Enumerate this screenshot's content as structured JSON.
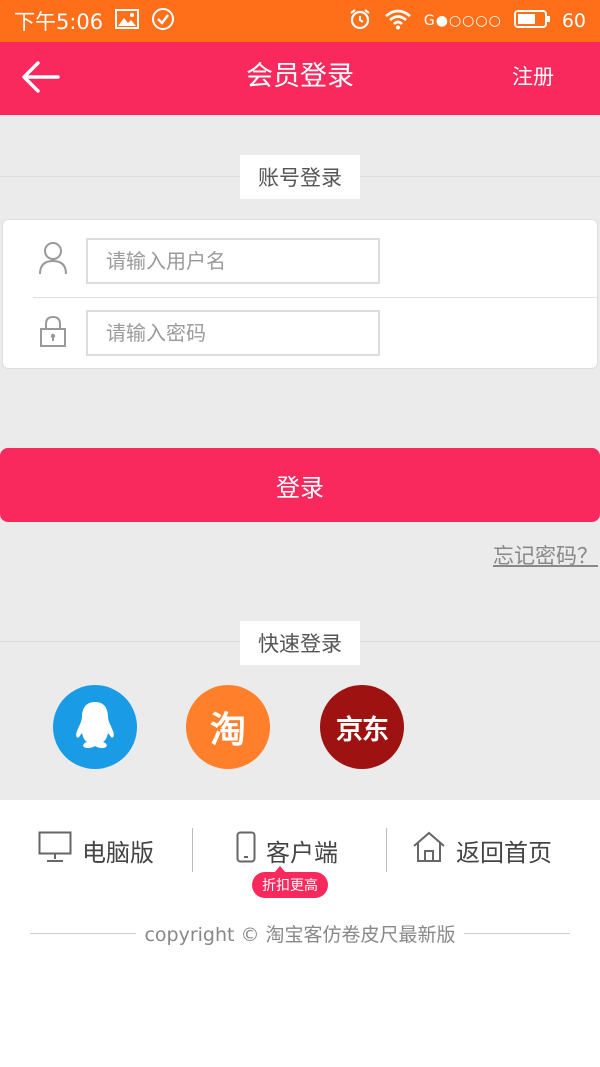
{
  "status_bar": {
    "time": "下午5:06",
    "network": "G●○○○○",
    "battery": "60"
  },
  "header": {
    "title": "会员登录",
    "register_label": "注册"
  },
  "account_section": {
    "label": "账号登录"
  },
  "form": {
    "username_placeholder": "请输入用户名",
    "password_placeholder": "请输入密码",
    "username_value": "",
    "password_value": ""
  },
  "login_button_label": "登录",
  "forgot_password_label": "忘记密码？",
  "quick_section": {
    "label": "快速登录",
    "taobao_glyph": "淘",
    "jd_glyph": "京东"
  },
  "footer": {
    "pc_label": "电脑版",
    "app_label": "客户端",
    "home_label": "返回首页",
    "promo_badge": "折扣更高",
    "copyright": "copyright © 淘宝客仿卷皮尺最新版"
  },
  "colors": {
    "status_bar": "#ff6f1a",
    "brand_pink": "#f9285d",
    "qq_blue": "#1a9be6",
    "taobao_orange": "#ff7f2a",
    "jd_red": "#9e1212"
  }
}
